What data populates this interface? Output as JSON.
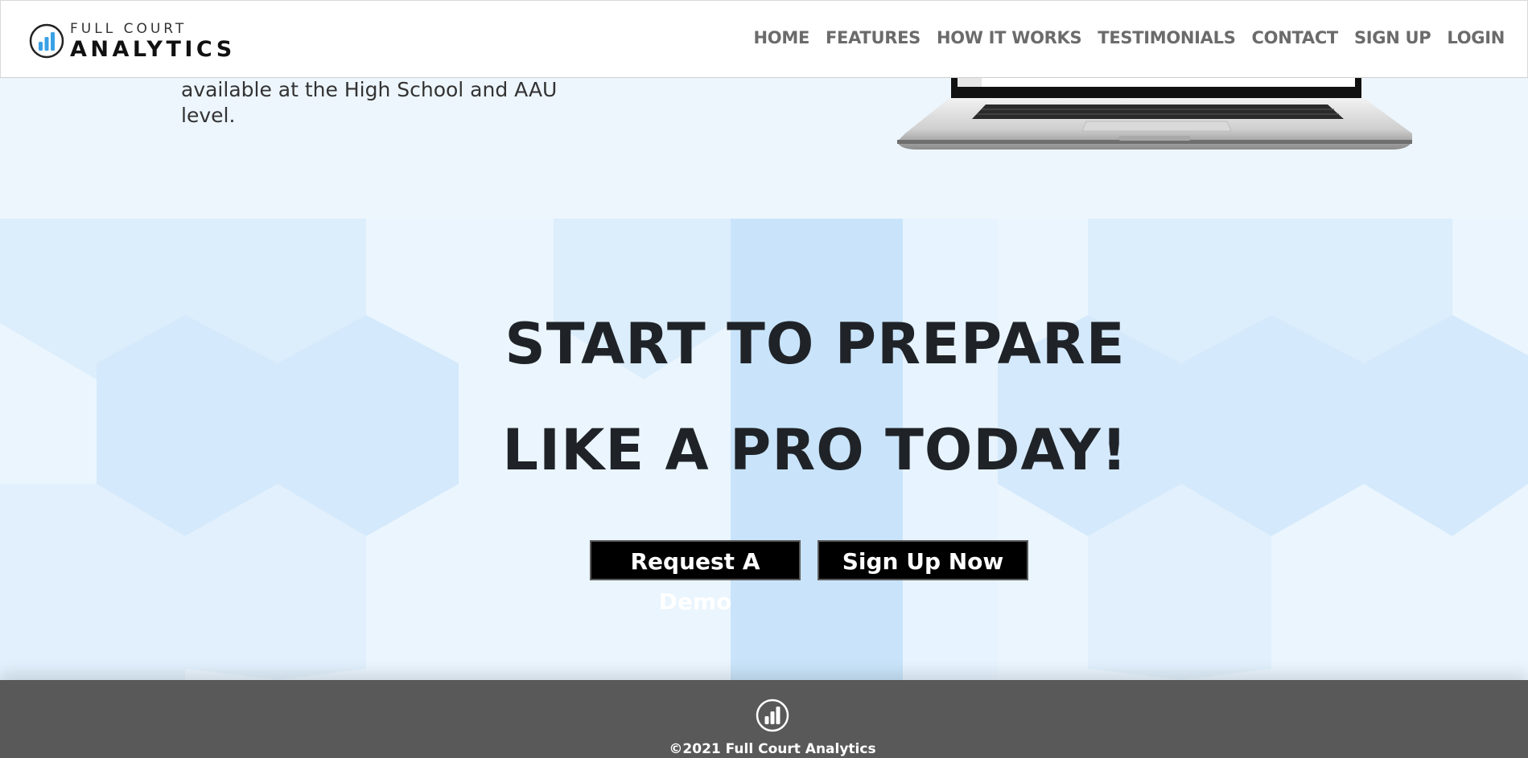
{
  "brand": {
    "name_top": "FULL COURT",
    "name_bottom": "ANALYTICS",
    "accent": "#3aa0e6"
  },
  "nav": {
    "items": [
      {
        "label": "HOME"
      },
      {
        "label": "FEATURES"
      },
      {
        "label": "HOW IT WORKS"
      },
      {
        "label": "TESTIMONIALS"
      },
      {
        "label": "CONTACT"
      },
      {
        "label": "SIGN UP"
      },
      {
        "label": "LOGIN"
      }
    ]
  },
  "intro": {
    "text": "available at the High School and AAU level."
  },
  "cta": {
    "title_line1": "START TO PREPARE",
    "title_line2": "LIKE A PRO TODAY!",
    "demo_button": "Request A Demo",
    "signup_button": "Sign Up Now"
  },
  "footer": {
    "copyright": "©2021 Full Court Analytics"
  },
  "colors": {
    "header_bg": "#ffffff",
    "nav_text": "#6b6b6b",
    "section_bg": "#e9f4fd",
    "hex_light": "#dcecfb",
    "hex_mid": "#cfe6fa",
    "footer_bg": "#595959",
    "button_bg": "#000000"
  }
}
